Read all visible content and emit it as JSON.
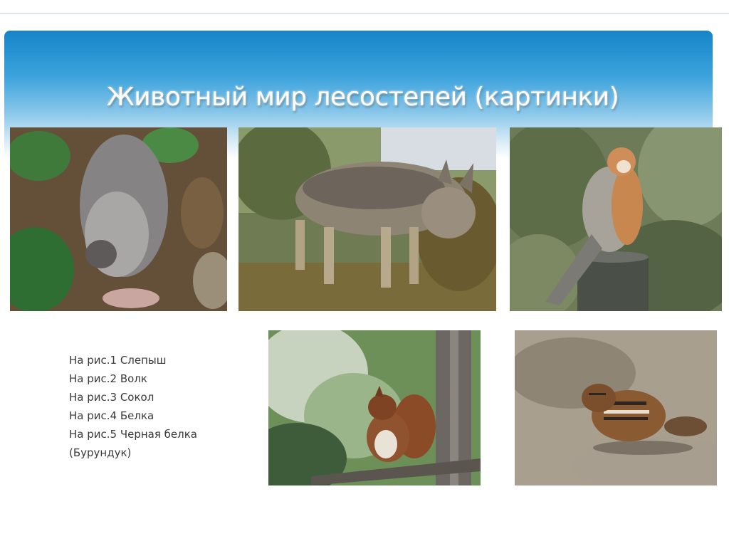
{
  "slide": {
    "title": "Животный мир лесостепей (картинки)",
    "accent_color": "#1684c8"
  },
  "photos": [
    {
      "subject": "mole-rat"
    },
    {
      "subject": "wolf"
    },
    {
      "subject": "falcon"
    },
    {
      "subject": "squirrel"
    },
    {
      "subject": "chipmunk"
    }
  ],
  "captions": [
    "На рис.1 Слепыш",
    "На рис.2  Волк",
    "На рис.3  Сокол",
    "На рис.4  Белка",
    "На рис.5  Черная белка",
    "(Бурундук)"
  ]
}
